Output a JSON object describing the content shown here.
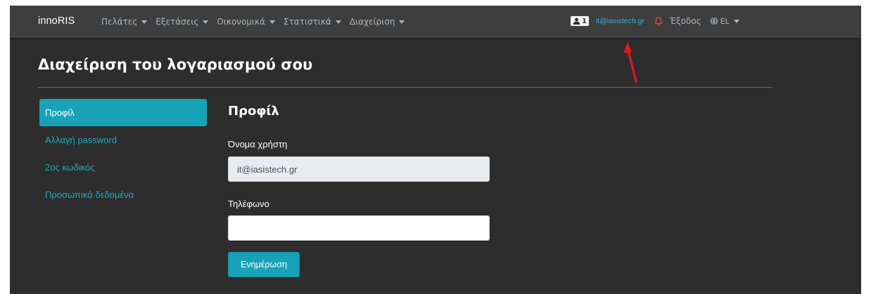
{
  "navbar": {
    "brand": "innoRIS",
    "menu": [
      {
        "label": "Πελάτες"
      },
      {
        "label": "Εξετάσεις"
      },
      {
        "label": "Οικονομικά"
      },
      {
        "label": "Στατιστικά"
      },
      {
        "label": "Διαχείριση"
      }
    ],
    "user_badge_count": "1",
    "user_email": "it@iasistech.gr",
    "logout_label": "Έξοδος",
    "language": "EL"
  },
  "page": {
    "title": "Διαχείριση του λογαριασμού σου"
  },
  "sidebar": {
    "items": [
      {
        "label": "Προφίλ",
        "active": true
      },
      {
        "label": "Αλλαγή password",
        "active": false
      },
      {
        "label": "2ος κωδικός",
        "active": false
      },
      {
        "label": "Προσωπικά δεδομένα",
        "active": false
      }
    ]
  },
  "profile": {
    "section_title": "Προφίλ",
    "username_label": "Όνομα χρήστη",
    "username_value": "it@iasistech.gr",
    "phone_label": "Τηλέφωνο",
    "phone_value": "",
    "update_label": "Ενημέρωση"
  },
  "colors": {
    "navbar_bg": "#3e3e3e",
    "page_bg": "#2d2d2d",
    "accent": "#17a2b8",
    "link": "#2fb6d0",
    "bell": "#e4434a",
    "annotation_arrow": "#e8161e"
  },
  "icons": {
    "user_badge": "user-icon",
    "notifications": "bell-icon",
    "language": "globe-icon",
    "dropdown": "caret-down-icon",
    "annotation": "red-arrow-icon"
  }
}
